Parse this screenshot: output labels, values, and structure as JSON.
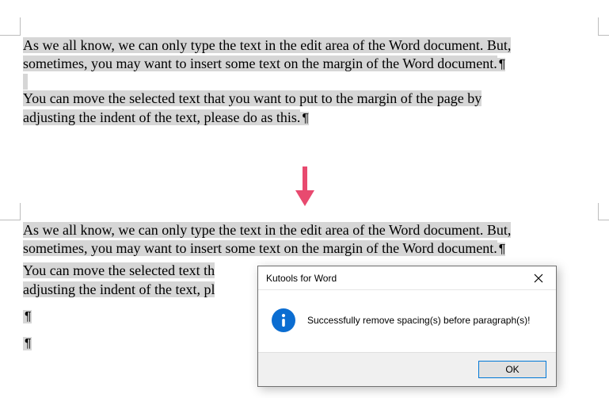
{
  "block1": {
    "para1_line1": "As we all know, we can only type the text in the edit area of the Word document. But,",
    "para1_line2": "sometimes, you may want to insert some text on the margin of the Word document.",
    "para2_line1": "You can move the selected text that you want to put to the margin of the page by",
    "para2_line2": "adjusting the indent of the text, please do as this."
  },
  "block2": {
    "para1_line1": "As we all know, we can only type the text in the edit area of the Word document. But,",
    "para1_line2": "sometimes, you may want to insert some text on the margin of the Word document.",
    "para2_line1_vis": "You can move the selected text th",
    "para2_line2_vis": "adjusting the indent of the text, pl"
  },
  "pilcrow": "¶",
  "dialog": {
    "title": "Kutools for Word",
    "message": "Successfully remove spacing(s) before paragraph(s)!",
    "ok": "OK"
  }
}
